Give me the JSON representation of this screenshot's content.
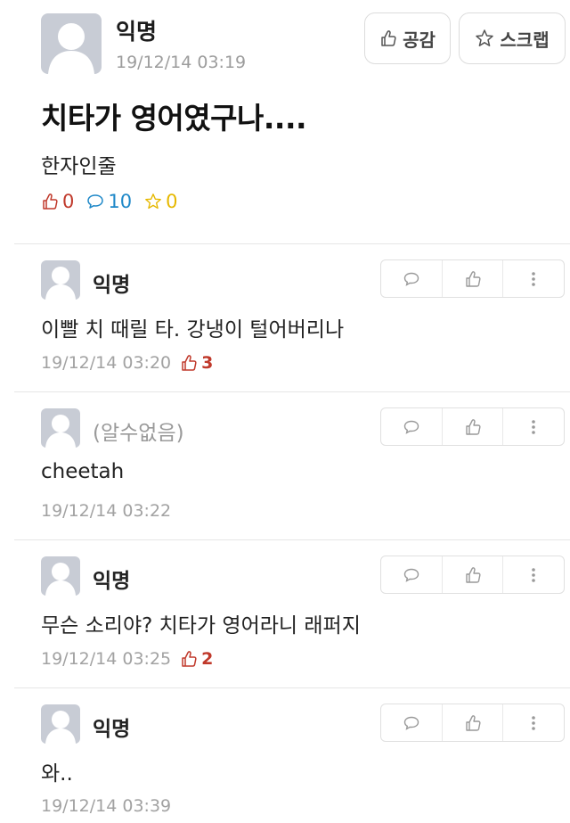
{
  "post": {
    "author": "익명",
    "time": "19/12/14 03:19",
    "like_button": "공감",
    "scrap_button": "스크랩",
    "title": "치타가 영어였구나....",
    "body": "한자인줄",
    "likes": "0",
    "comments": "10",
    "scraps": "0"
  },
  "comments": [
    {
      "author": "익명",
      "text": "이빨 치 때릴 타. 강냉이 털어버리나",
      "time": "19/12/14 03:20",
      "likes": "3"
    },
    {
      "author": "(알수없음)",
      "text": "cheetah",
      "time": "19/12/14 03:22",
      "likes": ""
    },
    {
      "author": "익명",
      "text": "무슨 소리야? 치타가 영어라니 래퍼지",
      "time": "19/12/14 03:25",
      "likes": "2"
    },
    {
      "author": "익명",
      "text": "와..",
      "time": "19/12/14 03:39",
      "likes": ""
    }
  ],
  "colors": {
    "like": "#c0392b",
    "comment": "#1e88c8",
    "scrap": "#e6b800",
    "avatar": "#c8ccd5"
  },
  "icons": {
    "like": "thumbs-up-icon",
    "comment": "speech-bubble-icon",
    "scrap": "star-icon",
    "more": "vertical-dots-icon"
  }
}
